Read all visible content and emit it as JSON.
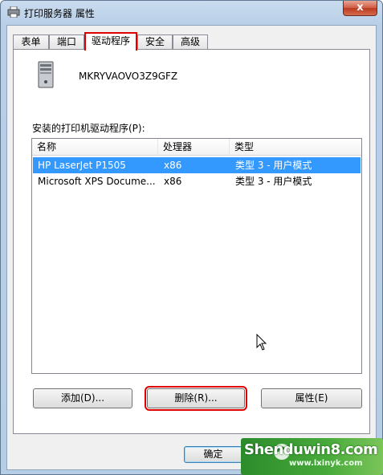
{
  "window": {
    "title": "打印服务器 属性",
    "close_glyph": "x"
  },
  "tabs": [
    {
      "label": "表单"
    },
    {
      "label": "端口"
    },
    {
      "label": "驱动程序"
    },
    {
      "label": "安全"
    },
    {
      "label": "高级"
    }
  ],
  "active_tab": "驱动程序",
  "server": {
    "name": "MKRYVAOVO3Z9GFZ",
    "icon": "computer-tower-icon"
  },
  "drivers": {
    "label": "安装的打印机驱动程序(P):",
    "columns": [
      "名称",
      "处理器",
      "类型"
    ],
    "rows": [
      {
        "name": "HP LaserJet P1505",
        "processor": "x86",
        "type": "类型 3 - 用户模式",
        "selected": true
      },
      {
        "name": "Microsoft XPS Docume...",
        "processor": "x86",
        "type": "类型 3 - 用户模式",
        "selected": false
      }
    ]
  },
  "buttons": {
    "add": "添加(D)...",
    "remove": "删除(R)...",
    "properties": "属性(E)",
    "ok": "确定"
  },
  "watermark": {
    "main": "Shenduwin8.com",
    "sub": "www.lxinyk.com"
  },
  "colors": {
    "selection": "#3399ff",
    "highlight_frame": "#e00000",
    "watermark_green": "#3a9a34"
  }
}
